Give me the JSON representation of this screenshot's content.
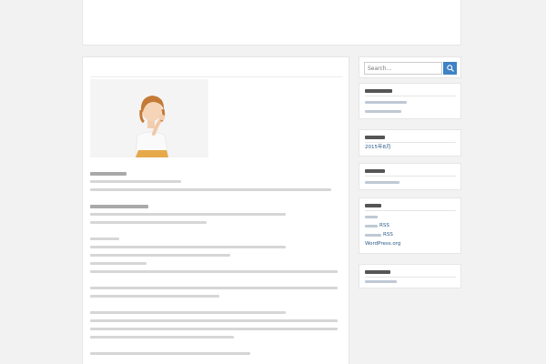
{
  "header": {
    "site_title": "",
    "site_description": ""
  },
  "post": {
    "title": "",
    "image": "woman-thinking-photo"
  },
  "sidebar": {
    "search_placeholder": "Search...",
    "search_icon": "search-icon",
    "widgets": {
      "archive_date": "2015年8月",
      "meta_links": [
        "RSS",
        "RSS",
        "WordPress.org"
      ]
    }
  },
  "colors": {
    "page_background": "#f2f2f2",
    "search_button": "#3f82c5",
    "link": "#2a5a8a"
  }
}
